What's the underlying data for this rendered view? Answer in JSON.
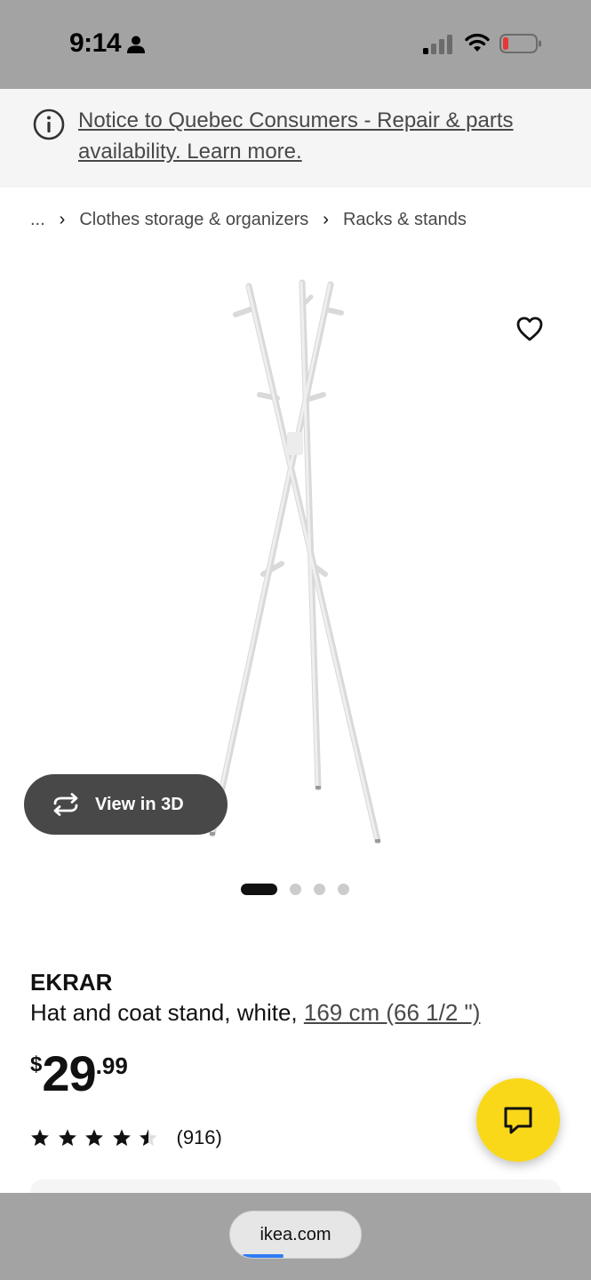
{
  "status_bar": {
    "time": "9:14",
    "icons": [
      "person-icon",
      "signal-icon",
      "wifi-icon",
      "battery-icon"
    ],
    "battery_color": "#e53935"
  },
  "notice": {
    "icon": "info-icon",
    "text": "Notice to Quebec Consumers - Repair & parts availability. Learn more."
  },
  "breadcrumb": {
    "items": [
      {
        "label": "..."
      },
      {
        "label": "Clothes storage & organizers"
      },
      {
        "label": "Racks & stands"
      }
    ],
    "separator": "›"
  },
  "gallery": {
    "favorite_icon": "heart-icon",
    "view_3d_label": "View in 3D",
    "view_3d_icon": "rotate-3d-icon",
    "image_count": 4,
    "active_index": 0
  },
  "product": {
    "name": "EKRAR",
    "description": "Hat and coat stand, white, ",
    "measurement": "169 cm (66 1/2 \")",
    "price": {
      "currency": "$",
      "integer": "29",
      "decimal": ".99"
    },
    "rating": {
      "value": 4.5,
      "max": 5,
      "review_count": "(916)"
    }
  },
  "chat": {
    "icon": "chat-bubble-icon",
    "color": "#f9d81a"
  },
  "browser": {
    "url": "ikea.com",
    "load_progress": 0.3,
    "progress_color": "#2f7bf5"
  }
}
